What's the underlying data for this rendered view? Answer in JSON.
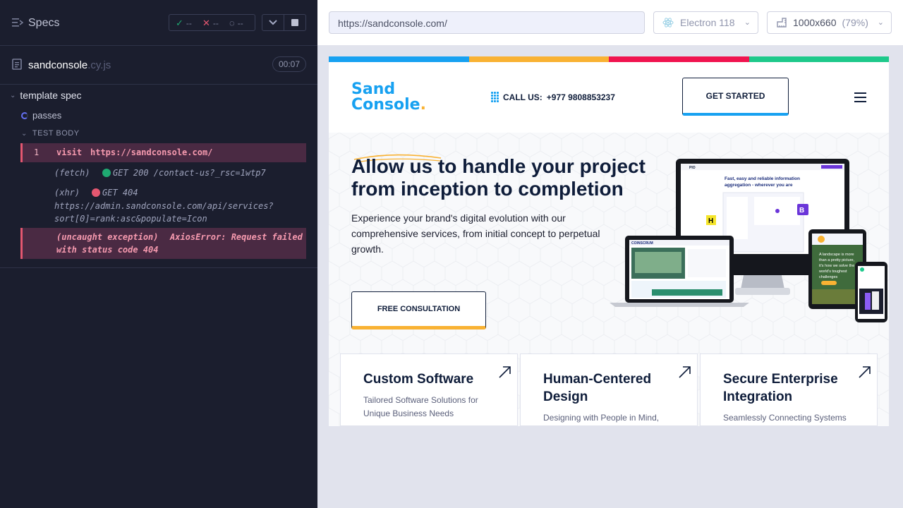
{
  "runner": {
    "title": "Specs",
    "stats": {
      "passed": "--",
      "failed": "--",
      "pending": "--"
    },
    "file": {
      "name": "sandconsole",
      "ext": ".cy.js",
      "duration": "00:07"
    },
    "suite": "template spec",
    "test": "passes",
    "body_label": "TEST BODY",
    "commands": {
      "visit": {
        "num": "1",
        "name": "visit",
        "arg": "https://sandconsole.com/"
      },
      "fetch": {
        "name": "(fetch)",
        "text": "GET 200 /contact-us?_rsc=1wtp7"
      },
      "xhr": {
        "name": "(xhr)",
        "line1": "GET 404",
        "line2": "https://admin.sandconsole.com/api/services?",
        "line3": "sort[0]=rank:asc&populate=Icon"
      },
      "error": {
        "name": "(uncaught exception)",
        "line1": "AxiosError: Request failed",
        "line2": "with status code 404"
      }
    }
  },
  "aut": {
    "url": "https://sandconsole.com/",
    "browser": "Electron 118",
    "viewport": "1000x660",
    "zoom": "(79%)"
  },
  "site": {
    "logo_line1": "Sand",
    "logo_line2": "Console",
    "logo_dot": ".",
    "call_label": "CALL US:",
    "phone": "+977 9808853237",
    "cta_primary": "GET STARTED",
    "hero_title": "Allow us to handle your project from inception to completion",
    "hero_sub": "Experience your brand's digital evolution with our comprehensive services, from initial concept to perpetual growth.",
    "cta_secondary": "FREE CONSULTATION",
    "cards": [
      {
        "title": "Custom Software",
        "desc": "Tailored Software Solutions for Unique Business Needs"
      },
      {
        "title": "Human-Centered Design",
        "desc": "Designing with People in Mind,"
      },
      {
        "title": "Secure Enterprise Integration",
        "desc": "Seamlessly Connecting Systems"
      }
    ],
    "mockup_text": {
      "monitor_headline": "Fast, easy and reliable information aggregation - wherever you are",
      "laptop_brand": "COINSCRUM",
      "tablet_text": "A landscape is more than a pretty picture, it's how we solve the world's toughest challenges"
    }
  },
  "colors": {
    "brand_blue": "#17a1f1",
    "brand_yellow": "#f9b233",
    "brand_red": "#f0144f",
    "brand_green": "#1ec98b",
    "navy": "#0f1d3a",
    "error_pink": "#e45770"
  }
}
